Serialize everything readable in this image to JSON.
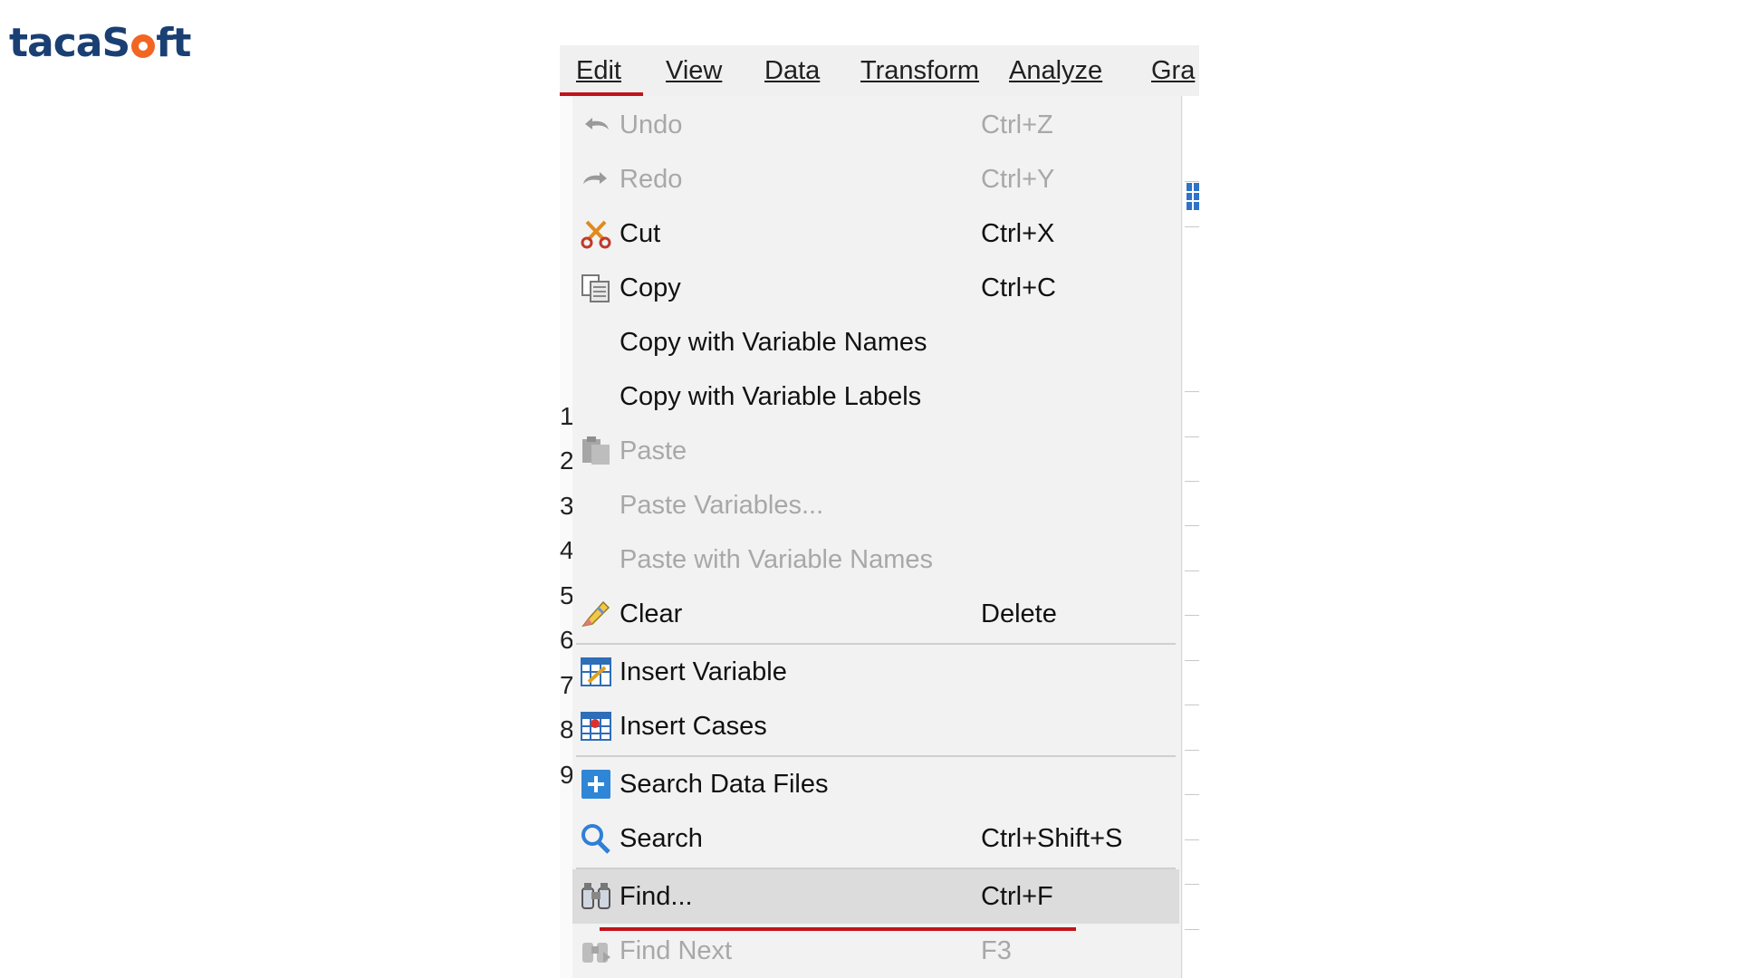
{
  "brand": {
    "text_before": "taca",
    "text_after": "ft",
    "accent": "#f26522",
    "color": "#1a3f73"
  },
  "menubar": {
    "items": [
      {
        "label": "Edit",
        "active": true
      },
      {
        "label": "View"
      },
      {
        "label": "Data"
      },
      {
        "label": "Transform"
      },
      {
        "label": "Analyze"
      },
      {
        "label": "Gra"
      }
    ]
  },
  "row_numbers": [
    "1",
    "2",
    "3",
    "4",
    "5",
    "6",
    "7",
    "8",
    "9"
  ],
  "edit_menu": {
    "items": [
      {
        "label": "Undo",
        "shortcut": "Ctrl+Z",
        "enabled": false,
        "icon": "undo-icon"
      },
      {
        "label": "Redo",
        "shortcut": "Ctrl+Y",
        "enabled": false,
        "icon": "redo-icon"
      },
      {
        "label": "Cut",
        "shortcut": "Ctrl+X",
        "enabled": true,
        "icon": "scissors-icon"
      },
      {
        "label": "Copy",
        "shortcut": "Ctrl+C",
        "enabled": true,
        "icon": "copy-icon"
      },
      {
        "label": "Copy with Variable Names",
        "shortcut": "",
        "enabled": true
      },
      {
        "label": "Copy with Variable Labels",
        "shortcut": "",
        "enabled": true
      },
      {
        "label": "Paste",
        "shortcut": "",
        "enabled": false,
        "icon": "paste-icon"
      },
      {
        "label": "Paste Variables...",
        "shortcut": "",
        "enabled": false
      },
      {
        "label": "Paste with Variable Names",
        "shortcut": "",
        "enabled": false
      },
      {
        "label": "Clear",
        "shortcut": "Delete",
        "enabled": true,
        "icon": "eraser-icon"
      },
      {
        "label": "Insert Variable",
        "shortcut": "",
        "enabled": true,
        "icon": "insert-variable-icon"
      },
      {
        "label": "Insert Cases",
        "shortcut": "",
        "enabled": true,
        "icon": "insert-cases-icon"
      },
      {
        "label": "Search Data Files",
        "shortcut": "",
        "enabled": true,
        "icon": "plus-square-icon"
      },
      {
        "label": "Search",
        "shortcut": "Ctrl+Shift+S",
        "enabled": true,
        "icon": "magnifier-icon"
      },
      {
        "label": "Find...",
        "shortcut": "Ctrl+F",
        "enabled": true,
        "highlighted": true,
        "icon": "binoculars-icon"
      },
      {
        "label": "Find Next",
        "shortcut": "F3",
        "enabled": false,
        "icon": "find-next-icon"
      }
    ]
  },
  "colors": {
    "highlight_underline": "#c0141b",
    "disabled_text": "#a8a8a8",
    "menu_bg": "#f2f2f2"
  }
}
